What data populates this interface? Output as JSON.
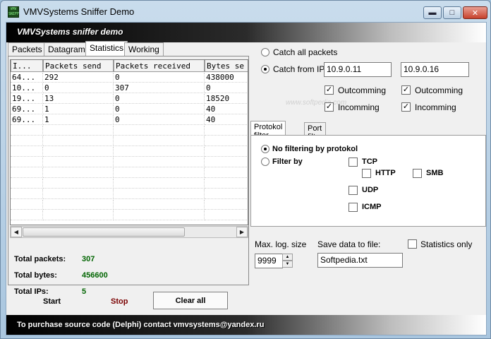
{
  "window": {
    "title": "VMVSystems Sniffer Demo",
    "icon_text": "VMV SNIFF",
    "min_glyph": "▬",
    "max_glyph": "□",
    "close_glyph": "✕"
  },
  "header": {
    "title": "VMVSystems sniffer demo"
  },
  "tabs": [
    {
      "label": "Packets",
      "active": false
    },
    {
      "label": "Datagram",
      "active": false
    },
    {
      "label": "Statistics",
      "active": true
    },
    {
      "label": "Working log",
      "active": false
    }
  ],
  "stats_table": {
    "columns": [
      "I...",
      "Packets send",
      "Packets received",
      "Bytes se"
    ],
    "rows": [
      [
        "64...",
        "292",
        "0",
        "438000"
      ],
      [
        "10...",
        "0",
        "307",
        "0"
      ],
      [
        "19...",
        "13",
        "0",
        "18520"
      ],
      [
        "69...",
        "1",
        "0",
        "40"
      ],
      [
        "69...",
        "1",
        "0",
        "40"
      ]
    ],
    "scroll_left": "◀",
    "scroll_right": "▶"
  },
  "totals": {
    "packets_label": "Total packets:",
    "packets_value": "307",
    "bytes_label": "Total bytes:",
    "bytes_value": "456600",
    "ips_label": "Total IPs:",
    "ips_value": "5"
  },
  "buttons": {
    "start": "Start",
    "stop": "Stop",
    "clear_all": "Clear all"
  },
  "capture": {
    "catch_all_label": "Catch all packets",
    "catch_from_label": "Catch from IPs",
    "ip1": "10.9.0.11",
    "ip2": "10.9.0.16",
    "outcoming_label": "Outcomming",
    "incoming_label": "Incomming",
    "check_glyph": "✓"
  },
  "watermark": "www.softpedia.com",
  "filter_tabs": [
    {
      "label": "Protokol filter",
      "active": true
    },
    {
      "label": "Port filter",
      "active": false
    }
  ],
  "filter": {
    "no_filter_label": "No filtering by protokol",
    "filter_by_label": "Filter by",
    "tcp": "TCP",
    "http": "HTTP",
    "smb": "SMB",
    "udp": "UDP",
    "icmp": "ICMP"
  },
  "log": {
    "max_size_label": "Max. log. size",
    "max_size_value": "9999",
    "save_label": "Save data to file:",
    "save_value": "Softpedia.txt",
    "stats_only_label": "Statistics only",
    "spin_up": "▲",
    "spin_down": "▼"
  },
  "footer": {
    "text": "To purchase source code (Delphi) contact vmvsystems@yandex.ru"
  },
  "colors": {
    "stat_value": "#006400",
    "stop_text": "#7a0000"
  }
}
